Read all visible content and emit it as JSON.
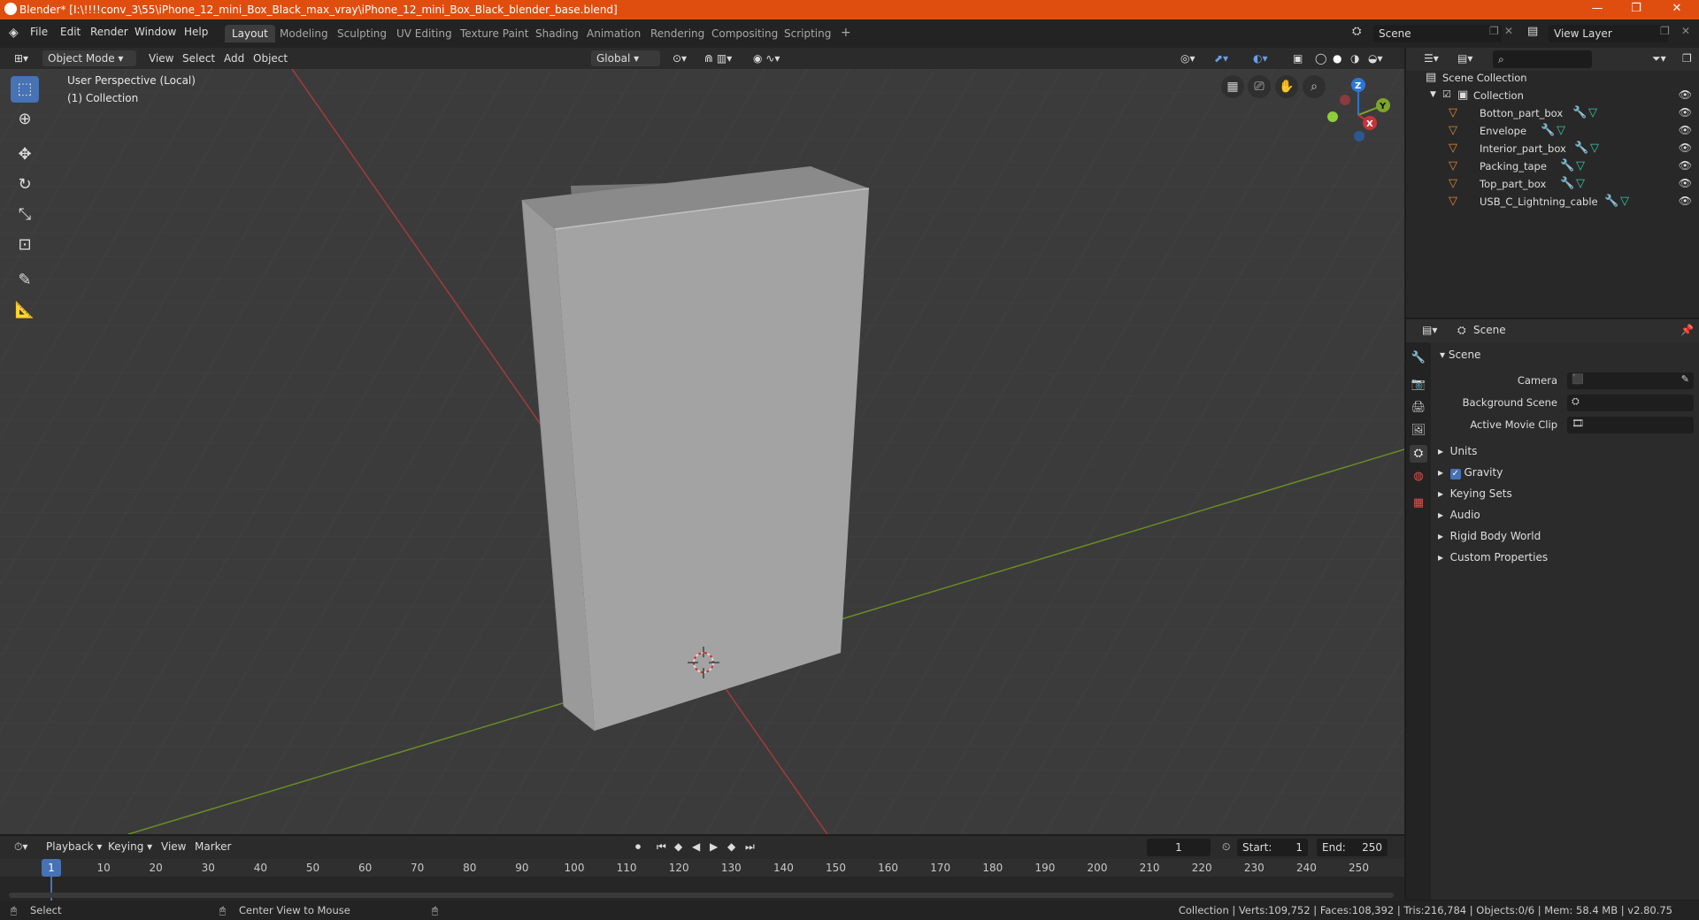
{
  "window": {
    "title": "Blender* [I:\\!!!!conv_3\\55\\iPhone_12_mini_Box_Black_max_vray\\iPhone_12_mini_Box_Black_blender_base.blend]",
    "controls": [
      "—",
      "❐",
      "✕"
    ]
  },
  "menubar": {
    "menus": [
      "File",
      "Edit",
      "Render",
      "Window",
      "Help"
    ],
    "workspaces": [
      "Layout",
      "Modeling",
      "Sculpting",
      "UV Editing",
      "Texture Paint",
      "Shading",
      "Animation",
      "Rendering",
      "Compositing",
      "Scripting"
    ],
    "active_workspace": "Layout",
    "add_tab": "+",
    "scene_field": "Scene",
    "view_layer_field": "View Layer"
  },
  "viewport_header": {
    "mode": "Object Mode",
    "menus": [
      "View",
      "Select",
      "Add",
      "Object"
    ],
    "transform_orientation": "Global"
  },
  "viewport": {
    "perspective_label": "User Perspective (Local)",
    "collection_label": "(1) Collection",
    "gizmo_axes": [
      "Z",
      "Y",
      "X"
    ]
  },
  "outliner": {
    "root": "Scene Collection",
    "collection": "Collection",
    "items": [
      "Botton_part_box",
      "Envelope",
      "Interior_part_box",
      "Packing_tape",
      "Top_part_box",
      "USB_C_Lightning_cable"
    ]
  },
  "properties": {
    "header": "Scene",
    "section": "Scene",
    "fields": [
      {
        "label": "Camera",
        "value": ""
      },
      {
        "label": "Background Scene",
        "value": ""
      },
      {
        "label": "Active Movie Clip",
        "value": ""
      }
    ],
    "subsections": [
      "Units",
      "Gravity",
      "Keying Sets",
      "Audio",
      "Rigid Body World",
      "Custom Properties"
    ],
    "gravity_enabled": true
  },
  "timeline": {
    "menus": [
      "Playback",
      "Keying",
      "View",
      "Marker"
    ],
    "current_frame": "1",
    "start_label": "Start:",
    "start": "1",
    "end_label": "End:",
    "end": "250",
    "ruler": [
      "1",
      "10",
      "20",
      "30",
      "40",
      "50",
      "60",
      "70",
      "80",
      "90",
      "100",
      "110",
      "120",
      "130",
      "140",
      "150",
      "160",
      "170",
      "180",
      "190",
      "200",
      "210",
      "220",
      "230",
      "240",
      "250"
    ]
  },
  "statusbar": {
    "left_action": "Select",
    "middle_action": "Center View to Mouse",
    "stats": "Collection | Verts:109,752 | Faces:108,392 | Tris:216,784 | Objects:0/6 | Mem: 58.4 MB | v2.80.75"
  },
  "colors": {
    "titlebar": "#e04e0f",
    "accent": "#4772b3",
    "x_axis": "#c8323a",
    "y_axis": "#7ba52c",
    "z_axis": "#2f75d6"
  }
}
